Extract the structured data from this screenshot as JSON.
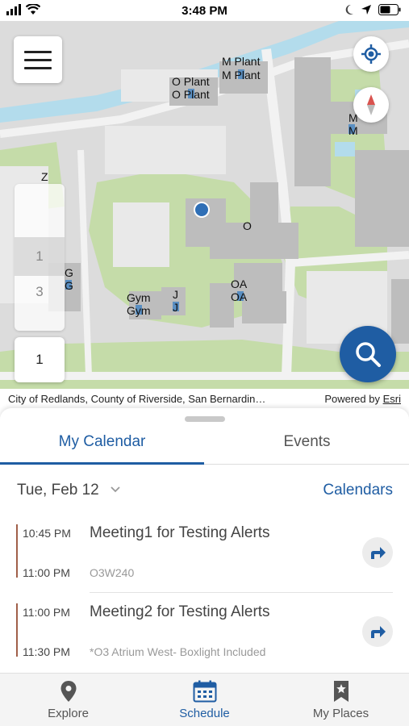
{
  "status_bar": {
    "time": "3:48 PM",
    "icons": [
      "signal-icon",
      "wifi-icon",
      "moon-icon",
      "location-arrow-icon",
      "battery-icon"
    ]
  },
  "map": {
    "labels": {
      "m_plant_1": "M Plant",
      "m_plant_2": "M Plant",
      "o_plant_1": "O Plant",
      "o_plant_2": "O Plant",
      "m_1": "M",
      "m_2": "M",
      "z": "Z",
      "o": "O",
      "g_1": "G",
      "g_2": "G",
      "gym_1": "Gym",
      "gym_2": "Gym",
      "j_1": "J",
      "j_2": "J",
      "oa_1": "OA",
      "oa_2": "OA"
    },
    "floor_picker": {
      "options": [
        "1",
        "3"
      ],
      "selected": "1",
      "current": "1"
    },
    "attribution": {
      "left": "City of Redlands, County of Riverside, San Bernardin…",
      "powered_by": "Powered by",
      "esri": "Esri"
    },
    "colors": {
      "road": "#f2f2f2",
      "grass": "#c5dca9",
      "building": "#bdbdbd",
      "water": "#b3dcec",
      "location_dot": "#2f6fb6"
    }
  },
  "sheet": {
    "tabs": {
      "my_calendar": "My Calendar",
      "events": "Events"
    },
    "date": "Tue, Feb 12",
    "calendars_link": "Calendars",
    "meetings": [
      {
        "start": "10:45 PM",
        "end": "11:00 PM",
        "title": "Meeting1 for Testing Alerts",
        "location": "O3W240"
      },
      {
        "start": "11:00 PM",
        "end": "11:30 PM",
        "title": "Meeting2 for Testing Alerts",
        "location": "*O3 Atrium West- Boxlight Included"
      }
    ]
  },
  "tabbar": {
    "explore": "Explore",
    "schedule": "Schedule",
    "my_places": "My Places"
  },
  "accent_color": "#1f5da3"
}
